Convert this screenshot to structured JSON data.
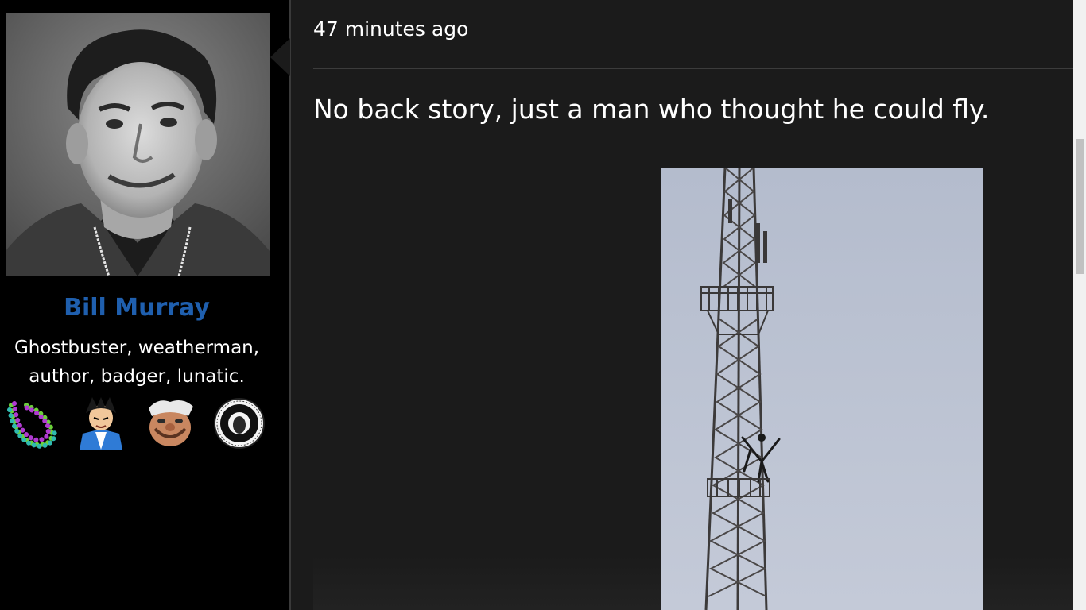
{
  "author": {
    "name": "Bill Murray",
    "bio_line1": "Ghostbuster, weatherman,",
    "bio_line2": "author, badger, lunatic."
  },
  "post": {
    "timestamp": "47 minutes ago",
    "text": "No back story, just a man who thought he could fly."
  },
  "colors": {
    "page_background": "#000000",
    "post_background": "#1b1b1b",
    "author_name": "#1f5fae",
    "text": "#ffffff",
    "divider": "#3a3a3a"
  },
  "icons": {
    "badge_1": "beads-necklace-icon",
    "badge_2": "anime-character-icon",
    "badge_3": "chef-muppet-icon",
    "badge_4": "round-seal-icon"
  }
}
